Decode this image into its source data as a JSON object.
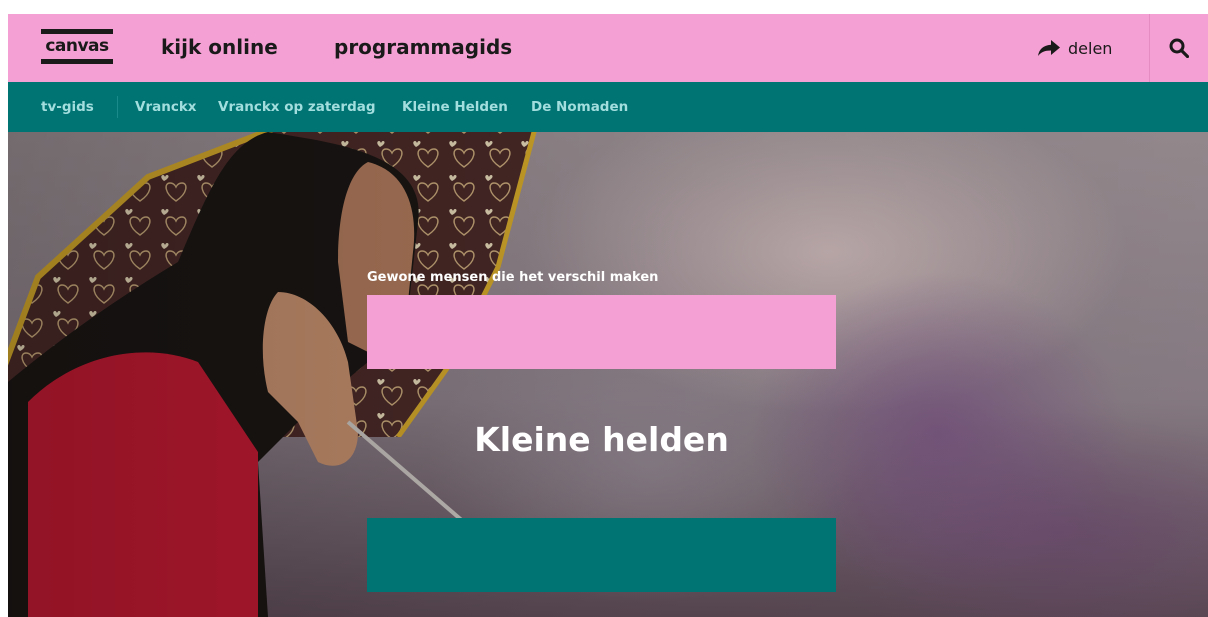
{
  "header": {
    "logo_text": "canvas",
    "nav": [
      {
        "label": "kijk online"
      },
      {
        "label": "programmagids"
      }
    ],
    "share_label": "delen",
    "share_icon": "share-arrow-icon",
    "search_icon": "search-icon"
  },
  "subnav": {
    "items": [
      {
        "label": "tv-gids"
      },
      {
        "label": "Vranckx"
      },
      {
        "label": "Vranckx op zaterdag"
      },
      {
        "label": "Kleine Helden"
      },
      {
        "label": "De Nomaden"
      }
    ]
  },
  "hero": {
    "kicker": "Gewone mensen die het verschil maken",
    "title": "Kleine helden"
  },
  "colors": {
    "brand_pink": "#f5a0d4",
    "brand_teal": "#007373",
    "subnav_text": "#a3dede"
  }
}
